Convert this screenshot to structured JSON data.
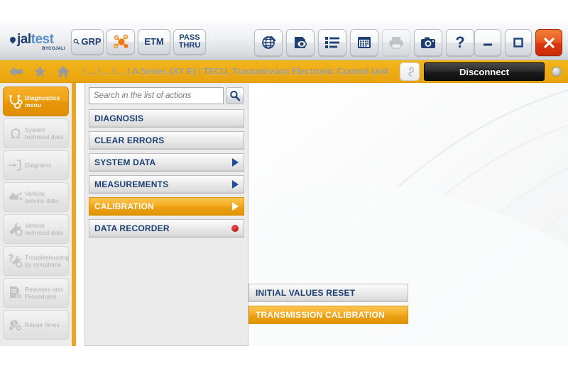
{
  "app": {
    "brand_main": "jal",
    "brand_main_light": "test",
    "brand_sub": "BYCOJALI"
  },
  "toolbar": {
    "left_buttons": [
      {
        "name": "grp-button",
        "label": "GRP",
        "icon": "magnifier-icon"
      },
      {
        "name": "network-button",
        "label": "",
        "icon": "network-nodes-icon"
      },
      {
        "name": "etm-button",
        "label": "ETM",
        "icon": ""
      },
      {
        "name": "pass-thru-button",
        "label_line1": "PASS",
        "label_line2": "THRU",
        "icon": ""
      }
    ],
    "center_buttons": [
      {
        "name": "web-button",
        "icon": "globe-icon",
        "label": ""
      },
      {
        "name": "preview-button",
        "icon": "eye-document-icon",
        "label": ""
      },
      {
        "name": "list-button",
        "icon": "list-icon",
        "label": ""
      },
      {
        "name": "calendar-button",
        "icon": "calendar-icon",
        "label": ""
      },
      {
        "name": "print-button",
        "icon": "printer-icon",
        "label": "",
        "disabled": true
      },
      {
        "name": "screenshot-button",
        "icon": "camera-icon",
        "label": ""
      },
      {
        "name": "help-button",
        "icon": "question-mark-icon",
        "label": "?"
      }
    ],
    "window_buttons": [
      {
        "name": "minimize-button",
        "icon": "minimize-icon"
      },
      {
        "name": "maximize-button",
        "icon": "maximize-icon"
      },
      {
        "name": "close-button",
        "icon": "close-icon"
      }
    ]
  },
  "breadcrumb": {
    "back_icon": "back-arrow-icon",
    "favorite_icon": "star-icon",
    "home_icon": "home-icon",
    "path": "\\ ... \\ ... \\ ... \\ A Series (XY E) \\ TECU, Transmission Electronic Control Unit",
    "plug_icon": "plug-connector-icon",
    "disconnect_label": "Disconnect",
    "status_led": "connection-status-led"
  },
  "sidebar": {
    "items": [
      {
        "label": "Diagnostics menu",
        "icon": "stethoscope-icon",
        "active": true
      },
      {
        "label": "System technical data",
        "icon": "omega-icon",
        "active": false
      },
      {
        "label": "Diagrams",
        "icon": "circuit-diagram-icon",
        "active": false
      },
      {
        "label": "Vehicle service data",
        "icon": "oil-can-icon",
        "active": false
      },
      {
        "label": "Vehicle technical data",
        "icon": "wrench-gear-icon",
        "active": false
      },
      {
        "label": "Troubleshooting by symptoms",
        "icon": "question-wrench-icon",
        "active": false
      },
      {
        "label": "Releases and Procedures",
        "icon": "document-gear-icon",
        "active": false
      },
      {
        "label": "Repair times",
        "icon": "clock-gears-icon",
        "active": false
      }
    ]
  },
  "search": {
    "value": "",
    "placeholder": "Search in the list of actions",
    "icon": "search-icon"
  },
  "actions": {
    "items": [
      {
        "label": "DIAGNOSIS",
        "marker": "none",
        "selected": false
      },
      {
        "label": "CLEAR ERRORS",
        "marker": "none",
        "selected": false
      },
      {
        "label": "SYSTEM DATA",
        "marker": "arrow",
        "selected": false
      },
      {
        "label": "MEASUREMENTS",
        "marker": "arrow",
        "selected": false
      },
      {
        "label": "CALIBRATION",
        "marker": "arrow",
        "selected": true
      },
      {
        "label": "DATA RECORDER",
        "marker": "record-dot",
        "selected": false
      }
    ]
  },
  "submenu": {
    "items": [
      {
        "label": "INITIAL VALUES RESET",
        "selected": false
      },
      {
        "label": "TRANSMISSION CALIBRATION",
        "selected": true
      }
    ]
  },
  "colors": {
    "accent_orange": "#eda014",
    "breadcrumb_gold": "#eeac13",
    "brand_blue": "#1d3f73",
    "close_red": "#d93a11",
    "record_red": "#c81e1e"
  }
}
